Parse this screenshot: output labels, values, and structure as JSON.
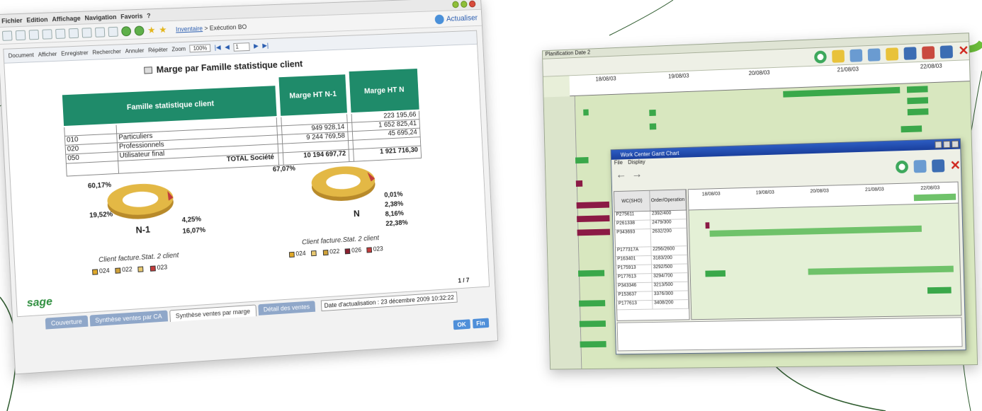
{
  "bo": {
    "menu": [
      "Fichier",
      "Edition",
      "Affichage",
      "Navigation",
      "Favoris",
      "?"
    ],
    "breadcrumb_link": "Inventaire",
    "breadcrumb_rest": "> Exécution BO",
    "refresh_label": "Actualiser",
    "toolbar2": {
      "document": "Document",
      "afficher": "Afficher",
      "enregistrer": "Enregistrer",
      "rechercher": "Rechercher",
      "annuler": "Annuler",
      "repeter": "Répéter",
      "zoom_label": "Zoom",
      "zoom_value": "100%",
      "page_value": "1"
    },
    "report": {
      "title": "Marge par Famille statistique client",
      "col_famille": "Famille statistique client",
      "col_n1": "Marge HT N-1",
      "col_n": "Marge HT N",
      "rows": [
        {
          "code": "",
          "label": "",
          "n1": "",
          "n": "223 195,66"
        },
        {
          "code": "010",
          "label": "Particuliers",
          "n1": "949 928,14",
          "n": "1 652 825,41"
        },
        {
          "code": "020",
          "label": "Professionnels",
          "n1": "9 244 769,58",
          "n": "45 695,24"
        },
        {
          "code": "050",
          "label": "Utilisateur final",
          "n1": "",
          "n": ""
        }
      ],
      "total": {
        "label": "TOTAL Société",
        "n1": "10 194 697,72",
        "n": "1 921 716,30"
      },
      "donut_left": {
        "label": "N-1",
        "pcts": [
          "60,17%",
          "19,52%",
          "4,25%",
          "16,07%"
        ]
      },
      "donut_right": {
        "label": "N",
        "pcts": [
          "67,07%",
          "0,01%",
          "2,38%",
          "8,16%",
          "22,38%"
        ]
      },
      "legend_title": "Client facture.Stat. 2 client",
      "legend_left": [
        "024",
        "022",
        "",
        "023"
      ],
      "legend_right": [
        "024",
        "",
        "022",
        "026",
        "023"
      ],
      "legend_colors": [
        "#e0a92a",
        "#cfa13a",
        "#8a2030",
        "#c33c3c"
      ],
      "page": "1 / 7",
      "logo": "sage"
    },
    "tabs": [
      "Couverture",
      "Synthèse ventes par CA",
      "Synthèse ventes par marge",
      "Détail des ventes"
    ],
    "date_text": "Date d'actualisation : 23 décembre 2009 10:32:22",
    "ok": "OK",
    "fin": "Fin"
  },
  "gantt": {
    "title": "Planification Date 2",
    "dates_top": [
      "18/08/03",
      "19/08/03",
      "20/08/03",
      "21/08/03",
      "22/08/03"
    ],
    "dialog": {
      "title": "Work Center Gantt Chart",
      "menu": [
        "File",
        "Display"
      ],
      "col1": "WC(SHO)",
      "col2": "Order/Operation",
      "dates": [
        "18/08/03",
        "19/08/03",
        "20/08/03",
        "21/08/03",
        "22/08/03"
      ],
      "rows": [
        [
          "P275611",
          "2392/400"
        ],
        [
          "P261338",
          "2479/300"
        ],
        [
          "P343693",
          "2632/200"
        ],
        [
          "P177317A",
          "2256/2600"
        ],
        [
          "P163401",
          "3183/200"
        ],
        [
          "P175913",
          "3292/500"
        ],
        [
          "P177613",
          "3294/700"
        ],
        [
          "P343346",
          "3213/500"
        ],
        [
          "P153637",
          "3376/300"
        ],
        [
          "P177613",
          "3408/200"
        ]
      ]
    }
  },
  "colors": {
    "table_header": "#1f8b6a",
    "gantt_bar": "#3aa84a",
    "gantt_bg": "#d8e7bf",
    "brand_green": "#2f8f3f"
  }
}
